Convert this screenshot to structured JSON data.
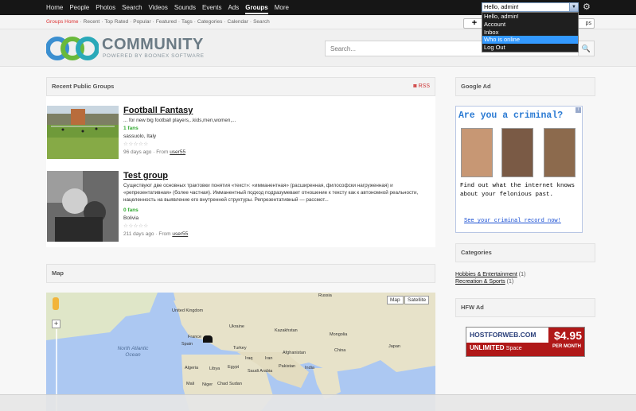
{
  "topnav": {
    "items": [
      {
        "label": "Home"
      },
      {
        "label": "People"
      },
      {
        "label": "Photos"
      },
      {
        "label": "Search"
      },
      {
        "label": "Videos"
      },
      {
        "label": "Sounds"
      },
      {
        "label": "Events"
      },
      {
        "label": "Ads"
      },
      {
        "label": "Groups"
      },
      {
        "label": "More"
      }
    ],
    "active": "Groups"
  },
  "user_menu": {
    "selected": "Hello, admin!",
    "options": [
      "Hello, admin!",
      "Account",
      "Inbox",
      "Who is online",
      "Log Out"
    ],
    "highlighted": "Who is online"
  },
  "subnav": {
    "items": [
      "Groups Home",
      "Recent",
      "Top Rated",
      "Popular",
      "Featured",
      "Tags",
      "Categories",
      "Calendar",
      "Search"
    ],
    "current": "Groups Home",
    "side_button": "ps"
  },
  "header": {
    "logo_text": "COMMUNITY",
    "logo_tagline": "POWERED BY BOONEX SOFTWARE",
    "search_placeholder": "Search..."
  },
  "groups": {
    "title": "Recent Public Groups",
    "rss_label": "RSS",
    "items": [
      {
        "title": "Football Fantasy",
        "description": "... for new big football players,..kids,men,women,...",
        "fans": "1 fans",
        "location": "sassuolo, Italy",
        "stars": "☆☆☆☆☆",
        "age": "96 days ago",
        "from_label": "From",
        "author": "user55"
      },
      {
        "title": "Test group",
        "description": "Существуют две основных трактовки понятия «текст»: «имманентная» (расширенная, философски нагруженная) и «репрезентативная» (более частная). Имманентный подход подразумевает отношение к тексту как к автономной реальности, нацеленность на выявление его внутренней структуры. Репрезентативный — рассмот...",
        "fans": "0 fans",
        "location": "Bolivia",
        "stars": "☆☆☆☆☆",
        "age": "211 days ago",
        "from_label": "From",
        "author": "user55"
      }
    ]
  },
  "map": {
    "title": "Map",
    "map_button": "Map",
    "satellite_button": "Satellite",
    "labels": [
      "Russia",
      "United Kingdom",
      "Ukraine",
      "Kazakhstan",
      "Mongolia",
      "France",
      "Spain",
      "Turkey",
      "China",
      "Japan",
      "Iraq",
      "Iran",
      "Afghanistan",
      "Algeria",
      "Libya",
      "Egypt",
      "Saudi Arabia",
      "Pakistan",
      "India",
      "Mali",
      "Niger",
      "Chad",
      "Sudan"
    ],
    "ocean_label": "North Atlantic Ocean"
  },
  "google_ad": {
    "title": "Google Ad",
    "headline": "Are you a criminal?",
    "body": "Find out what the internet knows about your felonious past.",
    "link": "See your criminal record now!"
  },
  "categories": {
    "title": "Categories",
    "items": [
      {
        "label": "Hobbies & Entertainment",
        "count": "(1)"
      },
      {
        "label": "Recreation & Sports",
        "count": "(1)"
      }
    ]
  },
  "hfw_ad": {
    "title": "HFW Ad",
    "brand": "HOSTFORWEB.COM",
    "tagline_bold": "UNLIMITED",
    "tagline_rest": "Space",
    "price": "$4.95",
    "per": "PER MONTH"
  },
  "colors": {
    "topbar": "#161616",
    "accent_red": "#dd3333",
    "fans_green": "#33aa33",
    "highlight_blue": "#3399ff"
  }
}
